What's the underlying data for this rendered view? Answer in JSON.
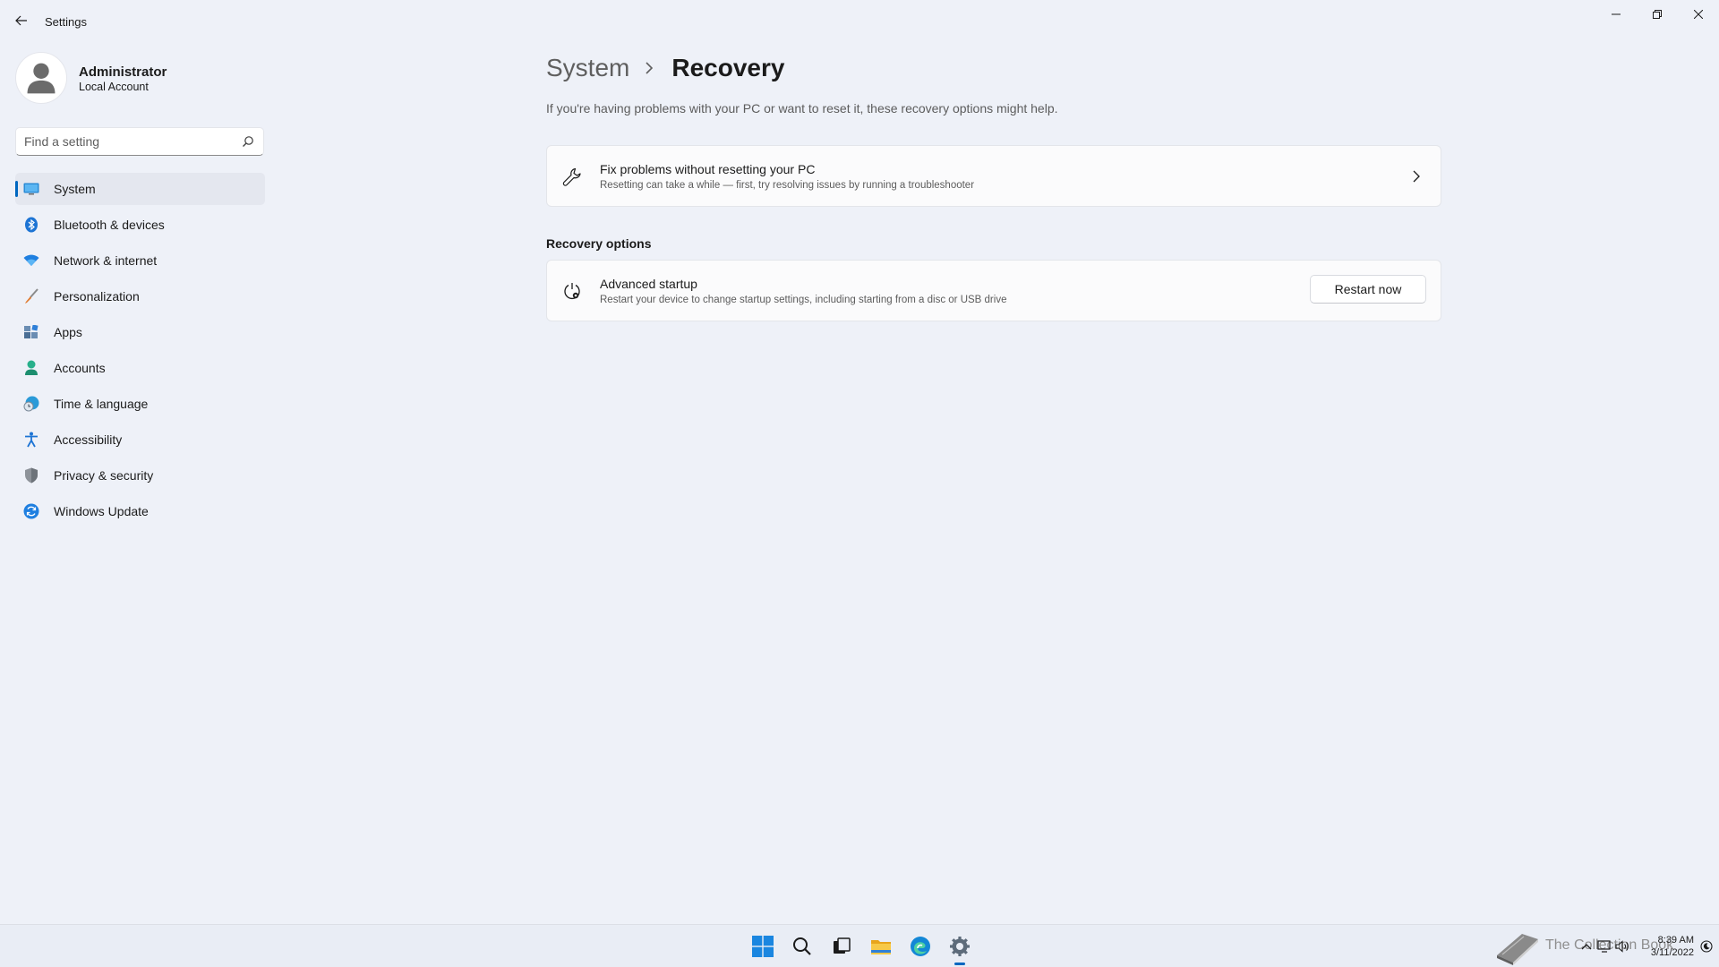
{
  "window": {
    "title": "Settings"
  },
  "profile": {
    "name": "Administrator",
    "account_type": "Local Account"
  },
  "search": {
    "placeholder": "Find a setting",
    "value": ""
  },
  "sidebar": {
    "items": [
      {
        "label": "System",
        "icon": "system-monitor-icon",
        "selected": true
      },
      {
        "label": "Bluetooth & devices",
        "icon": "bluetooth-icon"
      },
      {
        "label": "Network & internet",
        "icon": "wifi-icon"
      },
      {
        "label": "Personalization",
        "icon": "paintbrush-icon"
      },
      {
        "label": "Apps",
        "icon": "apps-icon"
      },
      {
        "label": "Accounts",
        "icon": "person-icon"
      },
      {
        "label": "Time & language",
        "icon": "globe-clock-icon"
      },
      {
        "label": "Accessibility",
        "icon": "accessibility-icon"
      },
      {
        "label": "Privacy & security",
        "icon": "shield-icon"
      },
      {
        "label": "Windows Update",
        "icon": "update-icon"
      }
    ]
  },
  "page": {
    "breadcrumb_parent": "System",
    "breadcrumb_current": "Recovery",
    "description": "If you're having problems with your PC or want to reset it, these recovery options might help.",
    "fix_card": {
      "title": "Fix problems without resetting your PC",
      "subtitle": "Resetting can take a while — first, try resolving issues by running a troubleshooter",
      "icon": "wrench-icon"
    },
    "recovery_options_heading": "Recovery options",
    "advanced_startup": {
      "title": "Advanced startup",
      "subtitle": "Restart your device to change startup settings, including starting from a disc or USB drive",
      "button_label": "Restart now",
      "icon": "advanced-startup-icon"
    }
  },
  "taskbar": {
    "apps": [
      "start-icon",
      "search-icon",
      "task-view-icon",
      "file-explorer-icon",
      "edge-icon",
      "settings-icon"
    ],
    "active_app": "settings-icon",
    "watermark": "The Collection Book",
    "clock_time": "8:39 AM",
    "clock_date": "3/11/2022"
  },
  "colors": {
    "accent": "#0067c0",
    "background": "#eef1f8",
    "card": "#fbfbfc"
  }
}
